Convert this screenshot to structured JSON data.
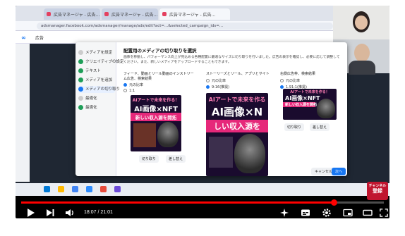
{
  "browser": {
    "tabs": [
      "広告マネージャ - 広告...",
      "広告マネージャ - 広告...",
      "広告マネージャ - 広告..."
    ],
    "url": "adsmanager.facebook.com/adsmanager/manage/ads/edit?act=...&selected_campaign_ids=..."
  },
  "fb": {
    "logo": "∞",
    "title": "広告"
  },
  "dialog": {
    "title": "配置用のメディアの切り取りを選択",
    "description": "画像を移動し、パフォーマンス向上が見込める各種配置に最適なサイズに切り取りを行いました。広告の表示を確認し、必要に応じて調整してください。また、新しいメディアをアップロードすることもできます。",
    "sidebar": [
      "メディアを設定",
      "クリエイティブの設定",
      "テキスト",
      "メディアを追加",
      "メディアの切り取り",
      "最適化",
      "最適化"
    ],
    "columns": [
      {
        "heading_line1": "フィード、動画とリール動画のインストリーム広告、検索結果",
        "ratio_a": "元の比率",
        "ratio_b": "1:1",
        "creative_top": "AIアートで未来を作る！",
        "creative_main": "AI画像×NFT",
        "creative_sub": "新しい収入源を開拓",
        "crop_label": "切り取り",
        "replace_label": "差し替え"
      },
      {
        "heading_line1": "ストーリーズとリール、アプリとサイト",
        "ratio_a": "元の比率",
        "ratio_b": "9:16(推奨)",
        "creative_top": "AIアートで未来を作る",
        "creative_main": "AI画像×N",
        "creative_sub": "しい収入源を",
        "crop_label": "",
        "replace_label": ""
      },
      {
        "heading_line1": "右側広告枠、検索結果",
        "ratio_a": "元の比率",
        "ratio_b": "1.91:1(推奨)",
        "creative_top": "AIアートで未来を作る！",
        "creative_main": "AI画像×NFT",
        "creative_sub": "新しい収入源を開拓",
        "crop_label": "切り取り",
        "replace_label": "差し替え"
      }
    ],
    "cancel_label": "キャンセル",
    "next_label": "次へ"
  },
  "badge": {
    "line1": "チャンネル",
    "line2": "登録"
  },
  "player": {
    "current_time": "18:07",
    "separator": " / ",
    "duration": "21:01",
    "progress": 0.862
  },
  "colors": {
    "accent": "#ff0000",
    "fb_blue": "#1877f2",
    "rec": "#c0152f"
  }
}
